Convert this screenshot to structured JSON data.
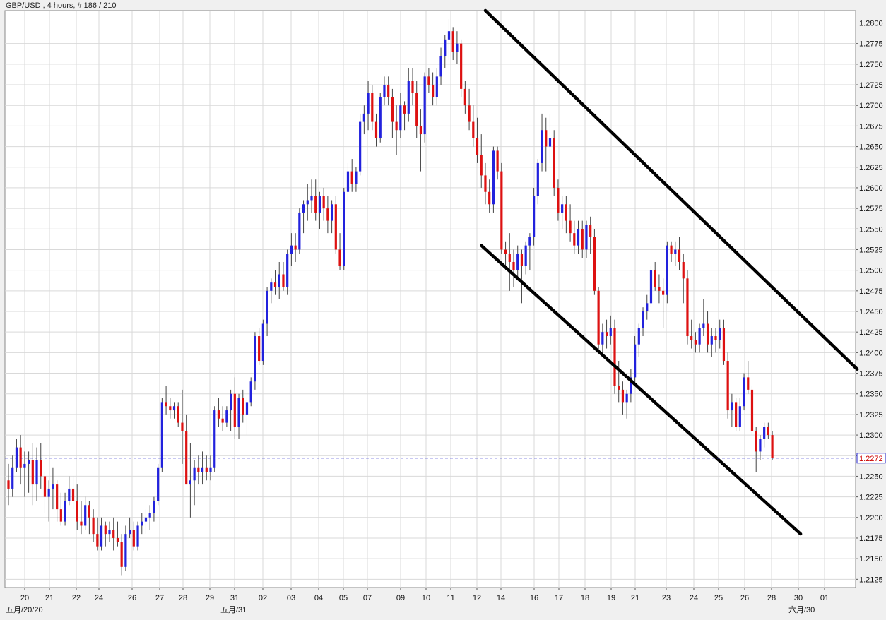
{
  "header": {
    "title": "GBP/USD , 4 hours, # 186 / 210"
  },
  "colors": {
    "up": "#2222dd",
    "down": "#dd1111",
    "wick": "#444444",
    "grid": "#d9d9d9",
    "current_line": "#2222cc",
    "current_label": "#cc0000",
    "trendline": "#000000",
    "background": "#ffffff",
    "frame": "#f0f0f0"
  },
  "chart_data": {
    "type": "candlestick",
    "symbol": "GBP/USD",
    "timeframe": "4 hours",
    "bar_counter": "# 186 / 210",
    "ylim": [
      1.2115,
      1.2815
    ],
    "y_ticks": [
      "1.2125",
      "1.2150",
      "1.2175",
      "1.2200",
      "1.2225",
      "1.2250",
      "1.2275",
      "1.2300",
      "1.2325",
      "1.2350",
      "1.2375",
      "1.2400",
      "1.2425",
      "1.2450",
      "1.2475",
      "1.2500",
      "1.2525",
      "1.2550",
      "1.2575",
      "1.2600",
      "1.2625",
      "1.2650",
      "1.2675",
      "1.2700",
      "1.2725",
      "1.2750",
      "1.2775",
      "1.2800"
    ],
    "x_ticks": [
      "20",
      "21",
      "22",
      "24",
      "26",
      "27",
      "28",
      "29",
      "31",
      "02",
      "03",
      "04",
      "05",
      "07",
      "09",
      "10",
      "11",
      "12",
      "14",
      "16",
      "17",
      "18",
      "19",
      "21",
      "23",
      "24",
      "25",
      "26",
      "28",
      "30",
      "01"
    ],
    "x_period_labels": [
      "五月/20/20",
      "五月/31",
      "六月/30"
    ],
    "current_price": "1.2272",
    "candles": [
      [
        1.2245,
        1.2265,
        1.2215,
        1.2235
      ],
      [
        1.2235,
        1.2275,
        1.2225,
        1.226
      ],
      [
        1.226,
        1.2295,
        1.2255,
        1.2285
      ],
      [
        1.2285,
        1.23,
        1.224,
        1.226
      ],
      [
        1.226,
        1.228,
        1.2225,
        1.2265
      ],
      [
        1.2265,
        1.228,
        1.223,
        1.227
      ],
      [
        1.227,
        1.229,
        1.2215,
        1.224
      ],
      [
        1.224,
        1.2285,
        1.222,
        1.227
      ],
      [
        1.227,
        1.229,
        1.2235,
        1.225
      ],
      [
        1.225,
        1.2255,
        1.2205,
        1.2225
      ],
      [
        1.2225,
        1.2245,
        1.2195,
        1.2235
      ],
      [
        1.2235,
        1.226,
        1.221,
        1.224
      ],
      [
        1.224,
        1.2245,
        1.2195,
        1.221
      ],
      [
        1.221,
        1.223,
        1.219,
        1.2195
      ],
      [
        1.2195,
        1.223,
        1.219,
        1.222
      ],
      [
        1.222,
        1.225,
        1.2215,
        1.2235
      ],
      [
        1.2235,
        1.225,
        1.221,
        1.222
      ],
      [
        1.222,
        1.224,
        1.2185,
        1.2195
      ],
      [
        1.2195,
        1.222,
        1.218,
        1.219
      ],
      [
        1.219,
        1.2225,
        1.2185,
        1.2215
      ],
      [
        1.2215,
        1.222,
        1.218,
        1.22
      ],
      [
        1.22,
        1.221,
        1.217,
        1.218
      ],
      [
        1.218,
        1.22,
        1.216,
        1.2165
      ],
      [
        1.2165,
        1.22,
        1.216,
        1.219
      ],
      [
        1.219,
        1.2195,
        1.2165,
        1.218
      ],
      [
        1.218,
        1.2195,
        1.217,
        1.2185
      ],
      [
        1.2185,
        1.22,
        1.216,
        1.2175
      ],
      [
        1.2175,
        1.2195,
        1.2165,
        1.217
      ],
      [
        1.217,
        1.218,
        1.213,
        1.214
      ],
      [
        1.214,
        1.219,
        1.2135,
        1.218
      ],
      [
        1.218,
        1.22,
        1.2175,
        1.2185
      ],
      [
        1.2185,
        1.2195,
        1.216,
        1.2165
      ],
      [
        1.2165,
        1.2195,
        1.216,
        1.219
      ],
      [
        1.219,
        1.2205,
        1.218,
        1.2195
      ],
      [
        1.2195,
        1.221,
        1.218,
        1.22
      ],
      [
        1.22,
        1.2215,
        1.2185,
        1.2205
      ],
      [
        1.2205,
        1.2225,
        1.2195,
        1.222
      ],
      [
        1.222,
        1.2265,
        1.2215,
        1.226
      ],
      [
        1.226,
        1.2345,
        1.2255,
        1.234
      ],
      [
        1.234,
        1.236,
        1.2325,
        1.2335
      ],
      [
        1.2335,
        1.2345,
        1.232,
        1.233
      ],
      [
        1.233,
        1.234,
        1.232,
        1.2335
      ],
      [
        1.2335,
        1.234,
        1.231,
        1.2315
      ],
      [
        1.2315,
        1.2355,
        1.2265,
        1.2305
      ],
      [
        1.2305,
        1.2325,
        1.226,
        1.224
      ],
      [
        1.224,
        1.229,
        1.22,
        1.2245
      ],
      [
        1.2245,
        1.227,
        1.2215,
        1.226
      ],
      [
        1.226,
        1.2275,
        1.224,
        1.2255
      ],
      [
        1.2255,
        1.228,
        1.224,
        1.226
      ],
      [
        1.226,
        1.2275,
        1.2245,
        1.2255
      ],
      [
        1.2255,
        1.2275,
        1.2245,
        1.226
      ],
      [
        1.226,
        1.2335,
        1.2255,
        1.233
      ],
      [
        1.233,
        1.2345,
        1.231,
        1.232
      ],
      [
        1.232,
        1.2335,
        1.2305,
        1.2315
      ],
      [
        1.2315,
        1.2335,
        1.231,
        1.233
      ],
      [
        1.233,
        1.2355,
        1.2305,
        1.235
      ],
      [
        1.235,
        1.237,
        1.2295,
        1.231
      ],
      [
        1.231,
        1.235,
        1.2295,
        1.2345
      ],
      [
        1.2345,
        1.2355,
        1.2315,
        1.2325
      ],
      [
        1.2325,
        1.2345,
        1.23,
        1.234
      ],
      [
        1.234,
        1.237,
        1.2335,
        1.2365
      ],
      [
        1.2365,
        1.2425,
        1.2355,
        1.242
      ],
      [
        1.242,
        1.243,
        1.2385,
        1.239
      ],
      [
        1.239,
        1.244,
        1.2385,
        1.2435
      ],
      [
        1.2435,
        1.248,
        1.242,
        1.2475
      ],
      [
        1.2475,
        1.249,
        1.246,
        1.2485
      ],
      [
        1.2485,
        1.25,
        1.247,
        1.248
      ],
      [
        1.248,
        1.251,
        1.2465,
        1.2495
      ],
      [
        1.2495,
        1.251,
        1.2475,
        1.248
      ],
      [
        1.248,
        1.2525,
        1.247,
        1.252
      ],
      [
        1.252,
        1.2545,
        1.2505,
        1.253
      ],
      [
        1.253,
        1.2545,
        1.251,
        1.2525
      ],
      [
        1.2525,
        1.2575,
        1.252,
        1.257
      ],
      [
        1.257,
        1.2585,
        1.2545,
        1.258
      ],
      [
        1.258,
        1.2605,
        1.256,
        1.2585
      ],
      [
        1.2585,
        1.261,
        1.257,
        1.259
      ],
      [
        1.259,
        1.261,
        1.256,
        1.257
      ],
      [
        1.257,
        1.2595,
        1.255,
        1.259
      ],
      [
        1.259,
        1.26,
        1.256,
        1.2575
      ],
      [
        1.2575,
        1.259,
        1.2545,
        1.256
      ],
      [
        1.256,
        1.2585,
        1.2545,
        1.258
      ],
      [
        1.258,
        1.259,
        1.252,
        1.2525
      ],
      [
        1.2525,
        1.2545,
        1.25,
        1.2505
      ],
      [
        1.2505,
        1.26,
        1.25,
        1.2595
      ],
      [
        1.2595,
        1.263,
        1.2585,
        1.262
      ],
      [
        1.262,
        1.2635,
        1.2595,
        1.2605
      ],
      [
        1.2605,
        1.2625,
        1.2595,
        1.262
      ],
      [
        1.262,
        1.269,
        1.2615,
        1.268
      ],
      [
        1.268,
        1.27,
        1.2665,
        1.269
      ],
      [
        1.269,
        1.273,
        1.267,
        1.2715
      ],
      [
        1.2715,
        1.2725,
        1.267,
        1.268
      ],
      [
        1.268,
        1.269,
        1.265,
        1.266
      ],
      [
        1.266,
        1.2715,
        1.2655,
        1.271
      ],
      [
        1.271,
        1.2735,
        1.27,
        1.2725
      ],
      [
        1.2725,
        1.2735,
        1.27,
        1.271
      ],
      [
        1.271,
        1.272,
        1.266,
        1.268
      ],
      [
        1.268,
        1.27,
        1.264,
        1.267
      ],
      [
        1.267,
        1.2715,
        1.266,
        1.27
      ],
      [
        1.27,
        1.2705,
        1.267,
        1.269
      ],
      [
        1.269,
        1.2745,
        1.268,
        1.273
      ],
      [
        1.273,
        1.2745,
        1.27,
        1.2715
      ],
      [
        1.2715,
        1.273,
        1.266,
        1.2675
      ],
      [
        1.2675,
        1.2695,
        1.262,
        1.2665
      ],
      [
        1.2665,
        1.274,
        1.2655,
        1.2735
      ],
      [
        1.2735,
        1.2745,
        1.2715,
        1.2725
      ],
      [
        1.2725,
        1.274,
        1.27,
        1.271
      ],
      [
        1.271,
        1.2745,
        1.27,
        1.2735
      ],
      [
        1.2735,
        1.277,
        1.2725,
        1.276
      ],
      [
        1.276,
        1.2785,
        1.2745,
        1.278
      ],
      [
        1.278,
        1.2805,
        1.2755,
        1.279
      ],
      [
        1.279,
        1.2795,
        1.2755,
        1.2765
      ],
      [
        1.2765,
        1.279,
        1.275,
        1.2775
      ],
      [
        1.2775,
        1.278,
        1.271,
        1.272
      ],
      [
        1.272,
        1.273,
        1.269,
        1.27
      ],
      [
        1.27,
        1.272,
        1.267,
        1.268
      ],
      [
        1.268,
        1.27,
        1.265,
        1.266
      ],
      [
        1.266,
        1.2685,
        1.263,
        1.264
      ],
      [
        1.264,
        1.2665,
        1.26,
        1.2615
      ],
      [
        1.2615,
        1.263,
        1.258,
        1.2595
      ],
      [
        1.2595,
        1.261,
        1.257,
        1.258
      ],
      [
        1.258,
        1.265,
        1.257,
        1.2645
      ],
      [
        1.2645,
        1.265,
        1.261,
        1.262
      ],
      [
        1.262,
        1.263,
        1.252,
        1.2525
      ],
      [
        1.2525,
        1.2535,
        1.25,
        1.252
      ],
      [
        1.252,
        1.2545,
        1.2475,
        1.251
      ],
      [
        1.251,
        1.2525,
        1.248,
        1.25
      ],
      [
        1.25,
        1.253,
        1.249,
        1.252
      ],
      [
        1.252,
        1.2525,
        1.246,
        1.2505
      ],
      [
        1.2505,
        1.2535,
        1.2495,
        1.253
      ],
      [
        1.253,
        1.2545,
        1.25,
        1.254
      ],
      [
        1.254,
        1.26,
        1.253,
        1.259
      ],
      [
        1.259,
        1.2635,
        1.258,
        1.263
      ],
      [
        1.263,
        1.269,
        1.262,
        1.267
      ],
      [
        1.267,
        1.2685,
        1.262,
        1.265
      ],
      [
        1.265,
        1.269,
        1.263,
        1.266
      ],
      [
        1.266,
        1.267,
        1.259,
        1.26
      ],
      [
        1.26,
        1.261,
        1.256,
        1.257
      ],
      [
        1.257,
        1.259,
        1.255,
        1.258
      ],
      [
        1.258,
        1.259,
        1.2545,
        1.256
      ],
      [
        1.256,
        1.258,
        1.2535,
        1.2545
      ],
      [
        1.2545,
        1.256,
        1.252,
        1.253
      ],
      [
        1.253,
        1.256,
        1.252,
        1.255
      ],
      [
        1.255,
        1.256,
        1.2515,
        1.2525
      ],
      [
        1.2525,
        1.256,
        1.2515,
        1.2555
      ],
      [
        1.2555,
        1.2565,
        1.252,
        1.254
      ],
      [
        1.254,
        1.255,
        1.247,
        1.2475
      ],
      [
        1.2475,
        1.248,
        1.24,
        1.241
      ],
      [
        1.241,
        1.2435,
        1.2395,
        1.2425
      ],
      [
        1.2425,
        1.244,
        1.2405,
        1.242
      ],
      [
        1.242,
        1.2445,
        1.241,
        1.243
      ],
      [
        1.243,
        1.244,
        1.235,
        1.236
      ],
      [
        1.236,
        1.239,
        1.234,
        1.2355
      ],
      [
        1.2355,
        1.2365,
        1.2325,
        1.234
      ],
      [
        1.234,
        1.2355,
        1.232,
        1.235
      ],
      [
        1.235,
        1.238,
        1.234,
        1.237
      ],
      [
        1.237,
        1.242,
        1.236,
        1.241
      ],
      [
        1.241,
        1.2435,
        1.2395,
        1.243
      ],
      [
        1.243,
        1.2455,
        1.242,
        1.245
      ],
      [
        1.245,
        1.247,
        1.244,
        1.246
      ],
      [
        1.246,
        1.2505,
        1.2455,
        1.25
      ],
      [
        1.25,
        1.251,
        1.2475,
        1.248
      ],
      [
        1.248,
        1.2495,
        1.246,
        1.2475
      ],
      [
        1.2475,
        1.249,
        1.243,
        1.247
      ],
      [
        1.247,
        1.2535,
        1.246,
        1.253
      ],
      [
        1.253,
        1.2535,
        1.251,
        1.252
      ],
      [
        1.252,
        1.2535,
        1.2505,
        1.2525
      ],
      [
        1.2525,
        1.254,
        1.25,
        1.251
      ],
      [
        1.251,
        1.252,
        1.246,
        1.249
      ],
      [
        1.249,
        1.25,
        1.241,
        1.242
      ],
      [
        1.242,
        1.244,
        1.2405,
        1.2415
      ],
      [
        1.2415,
        1.2425,
        1.24,
        1.241
      ],
      [
        1.241,
        1.2435,
        1.24,
        1.243
      ],
      [
        1.243,
        1.2465,
        1.242,
        1.2435
      ],
      [
        1.2435,
        1.245,
        1.24,
        1.241
      ],
      [
        1.241,
        1.243,
        1.2395,
        1.242
      ],
      [
        1.242,
        1.243,
        1.24,
        1.2415
      ],
      [
        1.2415,
        1.244,
        1.2405,
        1.243
      ],
      [
        1.243,
        1.244,
        1.2385,
        1.239
      ],
      [
        1.239,
        1.24,
        1.232,
        1.233
      ],
      [
        1.233,
        1.235,
        1.231,
        1.234
      ],
      [
        1.234,
        1.2345,
        1.2305,
        1.231
      ],
      [
        1.231,
        1.2345,
        1.2305,
        1.2335
      ],
      [
        1.2335,
        1.2375,
        1.233,
        1.237
      ],
      [
        1.237,
        1.239,
        1.235,
        1.2355
      ],
      [
        1.2355,
        1.236,
        1.23,
        1.2305
      ],
      [
        1.2305,
        1.231,
        1.2255,
        1.228
      ],
      [
        1.228,
        1.23,
        1.227,
        1.2295
      ],
      [
        1.2295,
        1.2315,
        1.2285,
        1.231
      ],
      [
        1.231,
        1.2315,
        1.2295,
        1.23
      ],
      [
        1.23,
        1.2305,
        1.227,
        1.2272
      ]
    ],
    "trendlines": [
      {
        "from": {
          "bar": 118,
          "price": 1.2815
        },
        "to": {
          "bar": 210,
          "price": 1.238
        }
      },
      {
        "from": {
          "bar": 117,
          "price": 1.253
        },
        "to": {
          "bar": 196,
          "price": 1.218
        }
      }
    ]
  }
}
